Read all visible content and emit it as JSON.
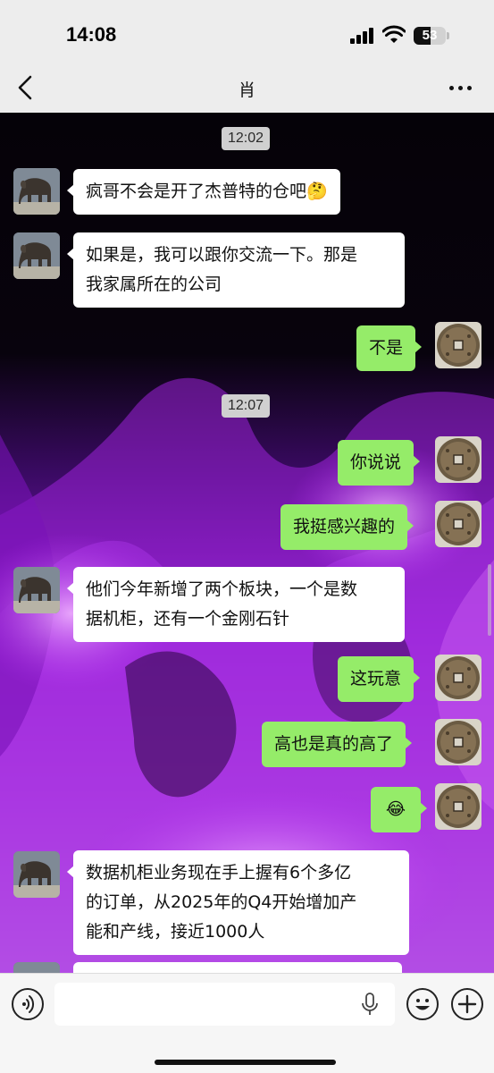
{
  "status_bar": {
    "time": "14:08",
    "battery": "53",
    "battery_level": 0.53
  },
  "nav": {
    "title": "肖",
    "back_icon": "chevron-left-icon",
    "more_icon": "ellipsis-icon"
  },
  "chat": {
    "timestamps": [
      "12:02",
      "12:07"
    ],
    "messages": [
      {
        "side": "left",
        "text": "疯哥不会是开了杰普特的仓吧🤔"
      },
      {
        "side": "left",
        "line1": "如果是，我可以跟你交流一下。那是",
        "line2": "我家属所在的公司"
      },
      {
        "side": "right",
        "text": "不是"
      },
      {
        "side": "right",
        "text": "你说说"
      },
      {
        "side": "right",
        "text": "我挺感兴趣的"
      },
      {
        "side": "left",
        "line1": "他们今年新增了两个板块，一个是数",
        "line2": "据机柜，还有一个金刚石针"
      },
      {
        "side": "right",
        "text": "这玩意"
      },
      {
        "side": "right",
        "text": "高也是真的高了"
      },
      {
        "side": "right",
        "text": "😂"
      },
      {
        "side": "left",
        "line1": "数据机柜业务现在手上握有6个多亿",
        "line2": "的订单，从2025年的Q4开始增加产",
        "line3": "能和产线，接近1000人"
      }
    ],
    "avatars": {
      "left": "elephant-statue-avatar",
      "right": "ancient-coin-avatar"
    }
  },
  "input_bar": {
    "placeholder": "",
    "voice_icon": "voice-icon",
    "mic_icon": "mic-icon",
    "emoji_icon": "emoji-icon",
    "plus_icon": "plus-icon"
  }
}
